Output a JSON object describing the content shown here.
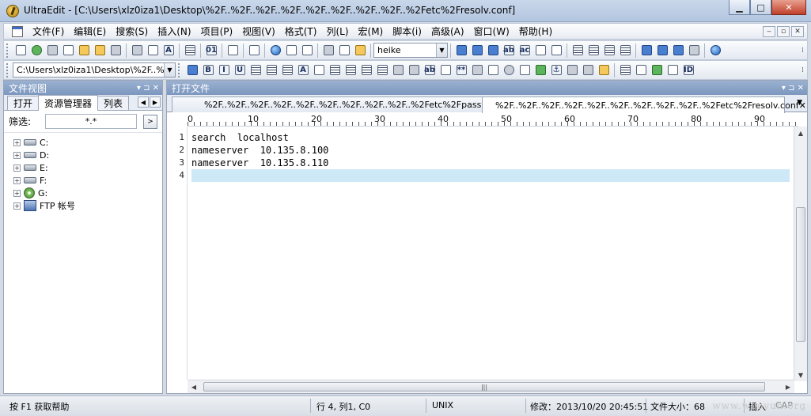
{
  "window": {
    "title": "UltraEdit - [C:\\Users\\xlz0iza1\\Desktop\\%2F..%2F..%2F..%2F..%2F..%2F..%2F..%2F..%2Fetc%2Fresolv.conf]",
    "minimize": "▁",
    "maximize": "□",
    "close": "✕"
  },
  "menu": {
    "items": [
      "文件(F)",
      "编辑(E)",
      "搜索(S)",
      "插入(N)",
      "项目(P)",
      "视图(V)",
      "格式(T)",
      "列(L)",
      "宏(M)",
      "脚本(i)",
      "高级(A)",
      "窗口(W)",
      "帮助(H)"
    ],
    "mdi": [
      "‒",
      "▫",
      "✕"
    ]
  },
  "toolbar1": {
    "search_combo": "heike"
  },
  "toolbar2": {
    "path_combo": "C:\\Users\\xlz0iza1\\Desktop\\%2F..%2"
  },
  "left_panel": {
    "title": "文件视图",
    "controls": "▾ ⊐ ✕",
    "tabs": [
      "打开",
      "资源管理器",
      "列表"
    ],
    "filter_label": "筛选:",
    "filter_value": "*.*",
    "filter_go": ">",
    "tree": [
      {
        "label": "C:",
        "icon": "drive"
      },
      {
        "label": "D:",
        "icon": "drive"
      },
      {
        "label": "E:",
        "icon": "drive"
      },
      {
        "label": "F:",
        "icon": "drive"
      },
      {
        "label": "G:",
        "icon": "cd"
      },
      {
        "label": "FTP 帐号",
        "icon": "ftp"
      }
    ]
  },
  "editor": {
    "panel_title": "打开文件",
    "controls": "▾ ⊐ ✕",
    "tabs": [
      {
        "label": "%2F..%2F..%2F..%2F..%2F..%2F..%2F..%2F..%2F..%2Fetc%2Fpasswd"
      },
      {
        "label": "%2F..%2F..%2F..%2F..%2F..%2F..%2F..%2F..%2F..%2Fetc%2Fresolv.conf",
        "active": true
      }
    ],
    "ruler": [
      "0",
      "10",
      "20",
      "30",
      "40",
      "50",
      "60",
      "70",
      "80",
      "90"
    ],
    "lines": [
      {
        "num": "1",
        "text": "search  localhost"
      },
      {
        "num": "2",
        "text": "nameserver  10.135.8.100"
      },
      {
        "num": "3",
        "text": "nameserver  10.135.8.110"
      },
      {
        "num": "4",
        "text": ""
      }
    ],
    "current_line_color": "#cde8f6"
  },
  "status": {
    "help": "按 F1 获取帮助",
    "position": "行 4, 列1, C0",
    "format": "UNIX",
    "modified": "修改：2013/10/20 20:45:51",
    "size": "文件大小：68",
    "insert": "插入",
    "caps": "CAP"
  },
  "watermark": "www.wooyun.org"
}
